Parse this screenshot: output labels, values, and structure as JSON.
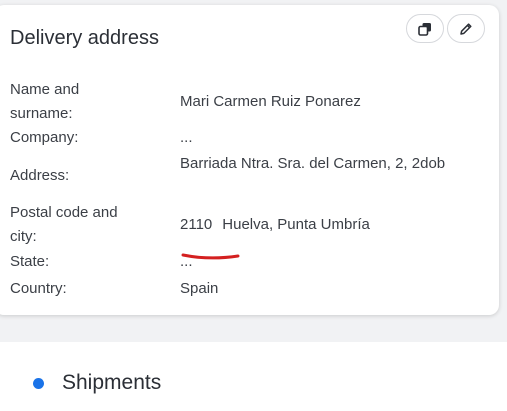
{
  "delivery_card": {
    "title": "Delivery address",
    "actions": [
      {
        "icon": "copy-icon"
      },
      {
        "icon": "pencil-icon"
      }
    ],
    "fields": {
      "name": {
        "label": "Name and surname:",
        "value": "Mari Carmen Ruiz Ponarez"
      },
      "company": {
        "label": "Company:",
        "value": "..."
      },
      "address": {
        "label": "Address:",
        "value": "Barriada Ntra. Sra. del Carmen, 2, 2dob"
      },
      "postal": {
        "label": "Postal code and city:",
        "code": "2110",
        "city": "Huelva, Punta Umbría"
      },
      "state": {
        "label": "State:",
        "value": "..."
      },
      "country": {
        "label": "Country:",
        "value": "Spain"
      }
    },
    "annotation_color": "#d42020"
  },
  "shipments": {
    "title": "Shipments",
    "dot_color": "#1a73e8"
  }
}
